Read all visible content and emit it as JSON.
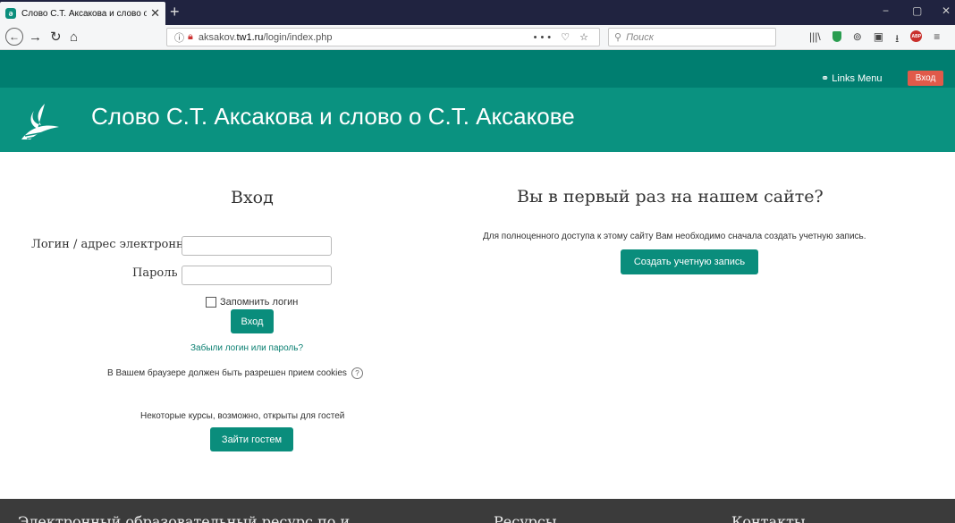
{
  "browser": {
    "tab_title": "Слово С.Т. Аксакова и слово о",
    "tab_close": "✕",
    "new_tab": "+",
    "url_prefix": "aksakov.",
    "url_host": "tw1.ru",
    "url_path": "/login/index.php",
    "url_actions": "••• ♡ ☆",
    "search_placeholder": "Поиск",
    "win_min": "−",
    "win_max": "▢",
    "win_close": "✕"
  },
  "header": {
    "links_menu": "Links Menu",
    "login_button": "Вход",
    "site_title": "Слово С.Т. Аксакова и слово о С.Т. Аксакове"
  },
  "login": {
    "heading": "Вход",
    "username_label": "Логин / адрес электронной почты",
    "username_value": "",
    "password_label": "Пароль",
    "password_value": "",
    "remember_label": "Запомнить логин",
    "submit_label": "Вход",
    "forgot_link": "Забыли логин или пароль?",
    "cookies_note": "В Вашем браузере должен быть разрешен прием cookies",
    "guest_note": "Некоторые курсы, возможно, открыты для гостей",
    "guest_button": "Зайти гостем"
  },
  "signup": {
    "heading": "Вы в первый раз на нашем сайте?",
    "info": "Для полноценного доступа к этому сайту Вам необходимо сначала создать учетную запись.",
    "create_button": "Создать учетную запись"
  },
  "footer": {
    "col1": "Электронный образовательный ресурс по и",
    "col2": "Ресурсы",
    "col3": "Контакты"
  },
  "colors": {
    "brand": "#0a9280",
    "topbar": "#007e70",
    "login_button": "#e05a4a",
    "footer": "#3b3b3b"
  }
}
